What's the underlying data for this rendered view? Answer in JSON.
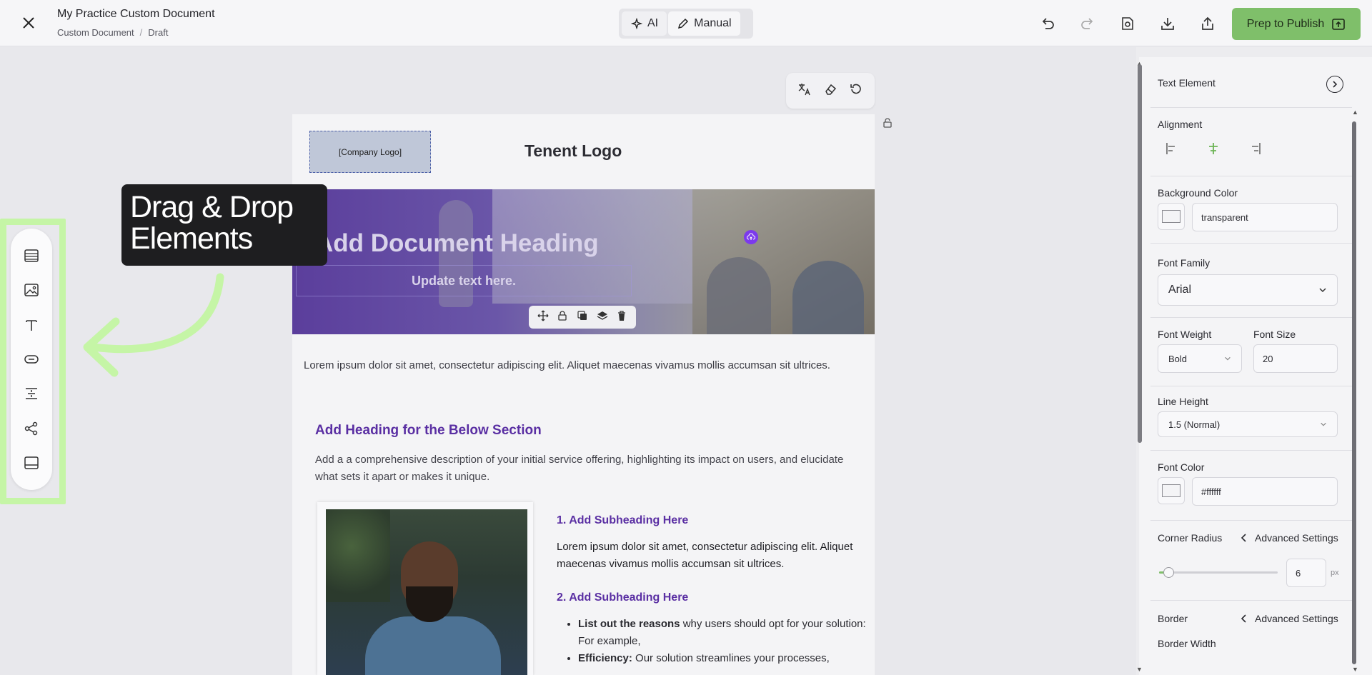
{
  "topbar": {
    "doc_title": "My Practice Custom Document",
    "breadcrumb": [
      "Custom Document",
      "Draft"
    ],
    "breadcrumb_sep": "/",
    "mode_ai": "AI",
    "mode_manual": "Manual",
    "publish_label": "Prep to Publish"
  },
  "elements_callout": {
    "line1": "Drag & Drop",
    "line2": "Elements"
  },
  "document": {
    "logo_placeholder": "[Company Logo]",
    "tenant_logo": "Tenent Logo",
    "hero_heading": "Add Document Heading",
    "hero_subtext": "Update text here.",
    "intro": "Lorem ipsum dolor sit amet, consectetur adipiscing elit. Aliquet maecenas vivamus mollis accumsan sit ultrices.",
    "section_heading": "Add Heading for the Below Section",
    "section_desc": "Add a a comprehensive description of your initial service offering, highlighting its impact on users, and elucidate what sets it apart or makes it unique.",
    "sub1_heading": "1. Add Subheading Here",
    "sub1_text": "Lorem ipsum dolor sit amet, consectetur adipiscing elit. Aliquet maecenas vivamus mollis accumsan sit ultrices.",
    "sub2_heading": "2. Add Subheading Here",
    "bullet1_bold": "List out the reasons",
    "bullet1_rest": " why users should opt for your solution: For example,",
    "bullet2_bold": "Efficiency:",
    "bullet2_rest": " Our solution streamlines your processes,"
  },
  "panel": {
    "title": "Text Element",
    "alignment_label": "Alignment",
    "alignment_selected": "center",
    "bg_color_label": "Background Color",
    "bg_color_value": "transparent",
    "font_family_label": "Font Family",
    "font_family_value": "Arial",
    "font_weight_label": "Font Weight",
    "font_weight_value": "Bold",
    "font_size_label": "Font Size",
    "font_size_value": "20",
    "line_height_label": "Line Height",
    "line_height_value": "1.5 (Normal)",
    "font_color_label": "Font Color",
    "font_color_value": "#ffffff",
    "corner_radius_label": "Corner Radius",
    "advanced_settings": "Advanced Settings",
    "corner_radius_value": "6",
    "corner_radius_unit": "px",
    "border_label": "Border",
    "border_width_label": "Border Width"
  },
  "colors": {
    "accent_green": "#7fbf6a",
    "heading_purple": "#5a2fa3",
    "highlight_green": "#c5f5a6"
  },
  "icons": {
    "elements_bar": [
      "table-icon",
      "image-icon",
      "text-icon",
      "button-icon",
      "spacer-icon",
      "share-icon",
      "footer-icon"
    ]
  }
}
